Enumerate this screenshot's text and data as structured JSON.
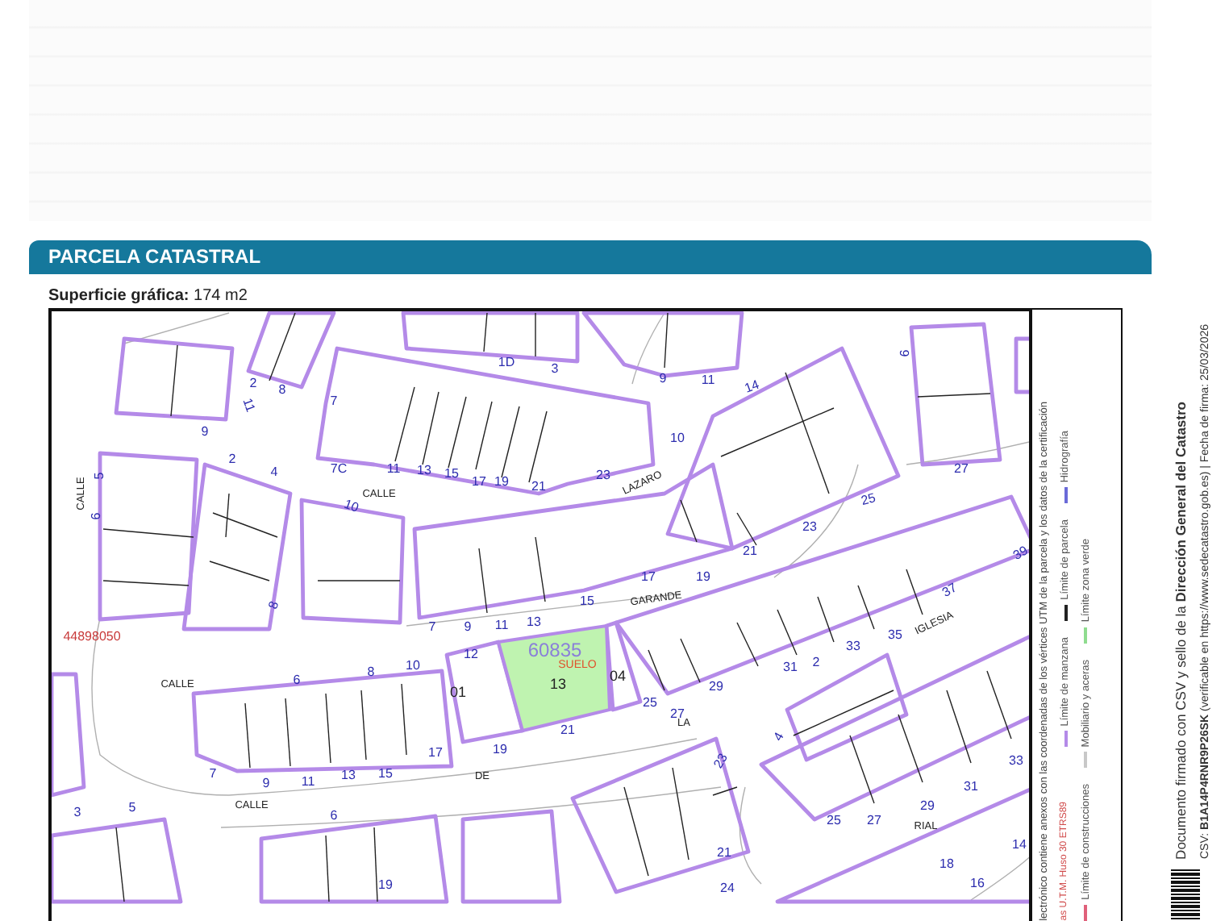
{
  "section": {
    "title": "PARCELA CATASTRAL"
  },
  "surface": "**Superficie gráfica:** 174 m2",
  "map": {
    "labels": [
      {
        "text": "1D",
        "kind": "number"
      },
      {
        "text": "3",
        "kind": "number"
      },
      {
        "text": "2",
        "kind": "number"
      },
      {
        "text": "8",
        "kind": "number"
      },
      {
        "text": "11",
        "kind": "number"
      },
      {
        "text": "9",
        "kind": "number"
      },
      {
        "text": "7",
        "kind": "number"
      },
      {
        "text": "7C",
        "kind": "number"
      },
      {
        "text": "11",
        "kind": "number"
      },
      {
        "text": "13",
        "kind": "number"
      },
      {
        "text": "15",
        "kind": "number"
      },
      {
        "text": "17",
        "kind": "number"
      },
      {
        "text": "19",
        "kind": "number"
      },
      {
        "text": "21",
        "kind": "number"
      },
      {
        "text": "CALLE",
        "kind": "street"
      },
      {
        "text": "10",
        "kind": "number"
      },
      {
        "text": "2",
        "kind": "number"
      },
      {
        "text": "4",
        "kind": "number"
      },
      {
        "text": "CALLE",
        "kind": "street"
      },
      {
        "text": "5",
        "kind": "number"
      },
      {
        "text": "6",
        "kind": "number"
      },
      {
        "text": "9",
        "kind": "number"
      },
      {
        "text": "11",
        "kind": "number"
      },
      {
        "text": "14",
        "kind": "number"
      },
      {
        "text": "10",
        "kind": "number"
      },
      {
        "text": "23",
        "kind": "number"
      },
      {
        "text": "LAZARO",
        "kind": "street"
      },
      {
        "text": "9",
        "kind": "number"
      },
      {
        "text": "27",
        "kind": "number"
      },
      {
        "text": "25",
        "kind": "number"
      },
      {
        "text": "23",
        "kind": "number"
      },
      {
        "text": "21",
        "kind": "number"
      },
      {
        "text": "17",
        "kind": "number"
      },
      {
        "text": "19",
        "kind": "number"
      },
      {
        "text": "39",
        "kind": "number"
      },
      {
        "text": "37",
        "kind": "number"
      },
      {
        "text": "GARANDE",
        "kind": "street"
      },
      {
        "text": "15",
        "kind": "number"
      },
      {
        "text": "7",
        "kind": "number"
      },
      {
        "text": "9",
        "kind": "number"
      },
      {
        "text": "11",
        "kind": "number"
      },
      {
        "text": "13",
        "kind": "number"
      },
      {
        "text": "12",
        "kind": "number"
      },
      {
        "text": "10",
        "kind": "number"
      },
      {
        "text": "8",
        "kind": "number"
      },
      {
        "text": "6",
        "kind": "number"
      },
      {
        "text": "CALLE",
        "kind": "street"
      },
      {
        "text": "44898050",
        "kind": "coordinate"
      },
      {
        "text": "60835",
        "kind": "parcel_ref"
      },
      {
        "text": "SUELO",
        "kind": "land_use"
      },
      {
        "text": "13",
        "kind": "parcel_number"
      },
      {
        "text": "04",
        "kind": "parcel_number"
      },
      {
        "text": "01",
        "kind": "parcel_number"
      },
      {
        "text": "25",
        "kind": "number"
      },
      {
        "text": "27",
        "kind": "number"
      },
      {
        "text": "29",
        "kind": "number"
      },
      {
        "text": "31",
        "kind": "number"
      },
      {
        "text": "2",
        "kind": "number"
      },
      {
        "text": "33",
        "kind": "number"
      },
      {
        "text": "35",
        "kind": "number"
      },
      {
        "text": "IGLESIA",
        "kind": "street"
      },
      {
        "text": "21",
        "kind": "number"
      },
      {
        "text": "19",
        "kind": "number"
      },
      {
        "text": "17",
        "kind": "number"
      },
      {
        "text": "LA",
        "kind": "street"
      },
      {
        "text": "7",
        "kind": "number"
      },
      {
        "text": "9",
        "kind": "number"
      },
      {
        "text": "11",
        "kind": "number"
      },
      {
        "text": "13",
        "kind": "number"
      },
      {
        "text": "15",
        "kind": "number"
      },
      {
        "text": "DE",
        "kind": "street"
      },
      {
        "text": "CALLE",
        "kind": "street"
      },
      {
        "text": "3",
        "kind": "number"
      },
      {
        "text": "5",
        "kind": "number"
      },
      {
        "text": "6",
        "kind": "number"
      },
      {
        "text": "23",
        "kind": "number"
      },
      {
        "text": "4",
        "kind": "number"
      },
      {
        "text": "25",
        "kind": "number"
      },
      {
        "text": "27",
        "kind": "number"
      },
      {
        "text": "29",
        "kind": "number"
      },
      {
        "text": "31",
        "kind": "number"
      },
      {
        "text": "33",
        "kind": "number"
      },
      {
        "text": "RIAL",
        "kind": "street"
      },
      {
        "text": "21",
        "kind": "number"
      },
      {
        "text": "19",
        "kind": "number"
      },
      {
        "text": "24",
        "kind": "number"
      },
      {
        "text": "18",
        "kind": "number"
      },
      {
        "text": "16",
        "kind": "number"
      },
      {
        "text": "14",
        "kind": "number"
      },
      {
        "text": "8",
        "kind": "number"
      }
    ]
  },
  "legend": {
    "columns": [
      [
        {
          "label": "Límite de manzana",
          "color": "#b48ae8"
        },
        {
          "label": "Límite de parcela",
          "color": "#222222"
        },
        {
          "label": "Hidrografía",
          "color": "#6a6ad8"
        }
      ],
      [
        {
          "label": "Límite de construcciones",
          "color": "#e0607a"
        },
        {
          "label": "Mobiliario y aceras",
          "color": "#c8c8c8"
        },
        {
          "label": "Límite zona verde",
          "color": "#8fdc8f"
        }
      ]
    ],
    "projection": "as U.T.M. Huso 30 ETRS89",
    "note": "lectrónico contiene anexos con las coordenadas de los vértices UTM de la parcela y los datos de la certificación"
  },
  "signature": {
    "line_1": "Documento firmado con CSV y sello de la **Dirección General del Catastro**",
    "line_2": "CSV: **B1A14P4RNR9P26SK** (verificable en https://www.sedecatastro.gob.es)  |  Fecha de firma: 25/03/2026"
  }
}
